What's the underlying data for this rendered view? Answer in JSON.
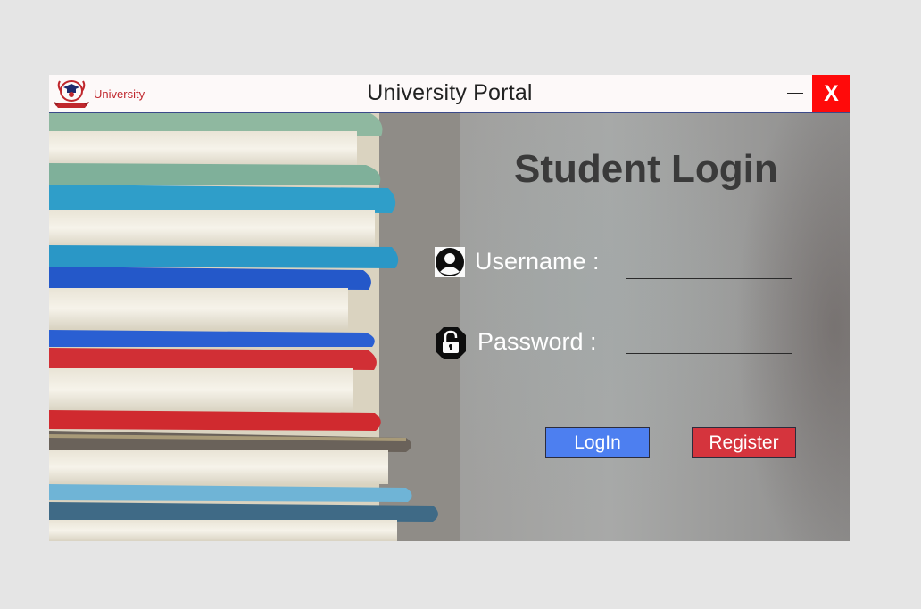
{
  "titlebar": {
    "logo_text": "University",
    "title": "University Portal",
    "minimize_label": "—",
    "close_label": "X"
  },
  "form": {
    "heading": "Student Login",
    "username_label": "Username :",
    "password_label": "Password :",
    "username_value": "",
    "password_value": ""
  },
  "buttons": {
    "login_label": "LogIn",
    "register_label": "Register"
  },
  "colors": {
    "close_bg": "#ff0a0a",
    "login_bg": "#4d7ff0",
    "register_bg": "#d5343d",
    "logo_red": "#c0272d"
  },
  "icons": {
    "logo": "university-emblem",
    "username": "user-icon",
    "password": "lock-icon"
  }
}
